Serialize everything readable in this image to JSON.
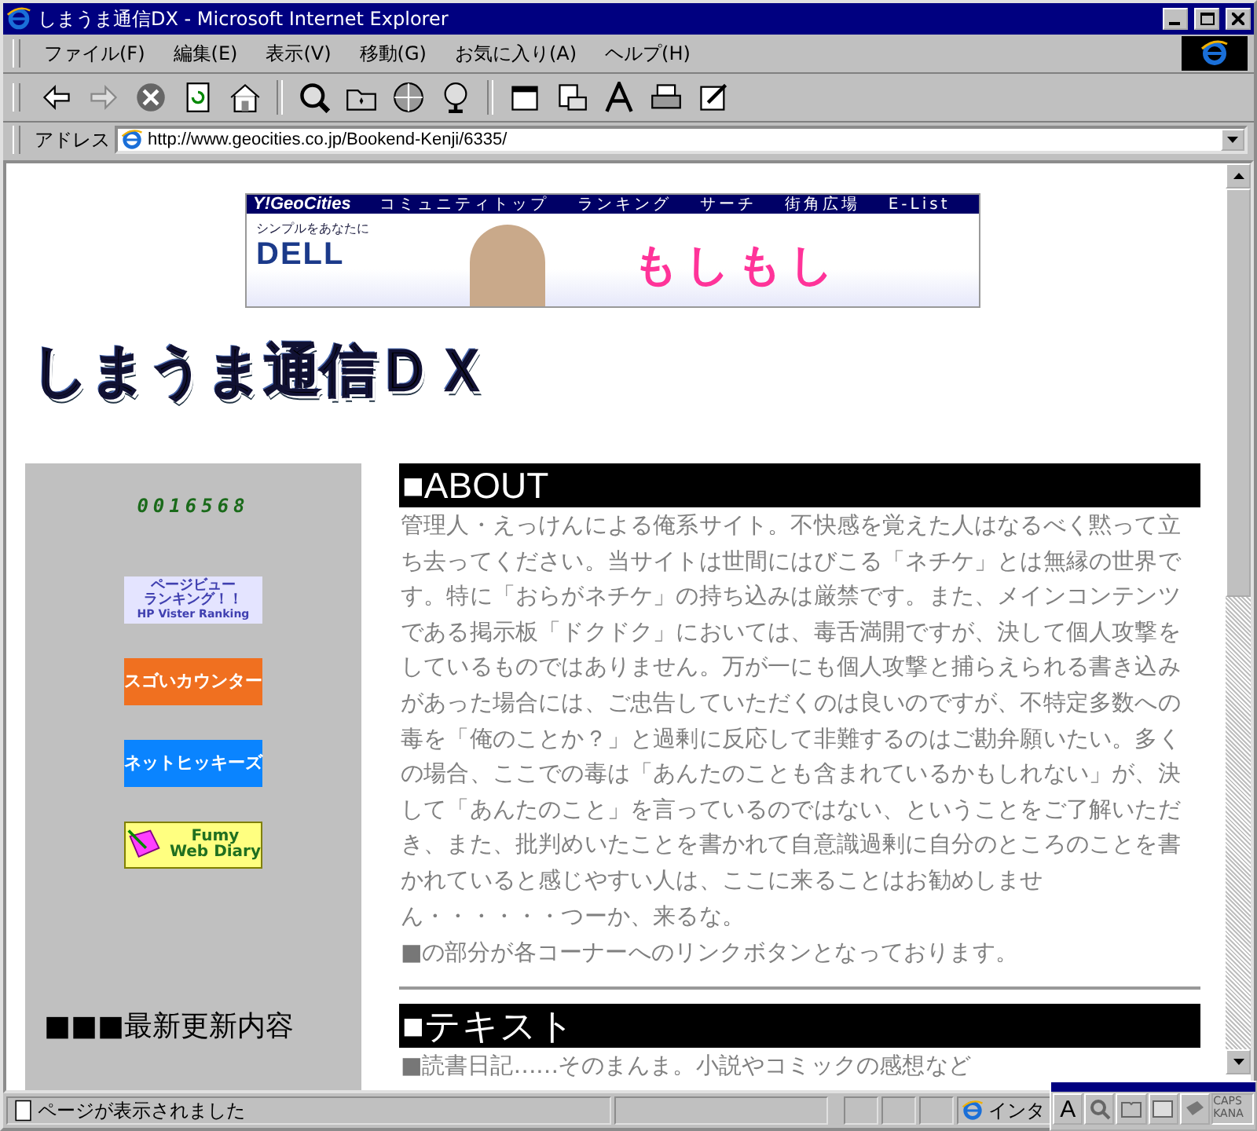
{
  "window": {
    "title": "しまうま通信DX - Microsoft Internet Explorer"
  },
  "menu": [
    "ファイル(F)",
    "編集(E)",
    "表示(V)",
    "移動(G)",
    "お気に入り(A)",
    "ヘルプ(H)"
  ],
  "address": {
    "label": "アドレス",
    "url": "http://www.geocities.co.jp/Bookend-Kenji/6335/"
  },
  "banner": {
    "brand": "Y!GeoCities",
    "links": [
      "コミュニティトップ",
      "ランキング",
      "サーチ",
      "街角広場",
      "E-List"
    ],
    "tagline": "シンプルをあなたに",
    "logo": "DELL",
    "ad_text": "もしもし"
  },
  "site_title": "しまうま通信ＤＸ",
  "sidebar": {
    "counter": "0016568",
    "badges": [
      {
        "kind": "ranking",
        "lines": [
          "ページビュー",
          "ランキング！！"
        ],
        "sub": "HP Vister Ranking"
      },
      {
        "kind": "orange",
        "lines": [
          "スゴいカウンター"
        ]
      },
      {
        "kind": "blue",
        "lines": [
          "ネットヒッキーズ"
        ]
      },
      {
        "kind": "diary",
        "lines": [
          "Fumy",
          "Web Diary"
        ]
      }
    ],
    "heading": "■■■最新更新内容"
  },
  "sections": [
    {
      "heading": "■ABOUT",
      "body": "管理人・えっけんによる俺系サイト。不快感を覚えた人はなるべく黙って立ち去ってください。当サイトは世間にはびこる「ネチケ」とは無縁の世界です。特に「おらがネチケ」の持ち込みは厳禁です。また、メインコンテンツである掲示板「ドクドク」においては、毒舌満開ですが、決して個人攻撃をしているものではありません。万が一にも個人攻撃と捕らえられる書き込みがあった場合には、ご忠告していただくのは良いのですが、不特定多数への毒を「俺のことか？」と過剰に反応して非難するのはご勘弁願いたい。多くの場合、ここでの毒は「あんたのことも含まれているかもしれない」が、決して「あんたのこと」を言っているのではない、ということをご了解いただき、また、批判めいたことを書かれて自意識過剰に自分のところのことを書かれていると感じやすい人は、ここに来ることはお勧めしません・・・・・・つーか、来るな。",
      "items": [
        {
          "marker": "■",
          "text": "の部分が各コーナーへのリンクボタンとなっております。"
        }
      ]
    },
    {
      "heading": "■テキスト",
      "items": [
        {
          "marker": "■",
          "text": "読書日記……そのまんま。小説やコミックの感想など"
        }
      ]
    }
  ],
  "status_bar": {
    "text": "ページが表示されました",
    "zone": "インタ"
  },
  "ime_bar": {
    "key": "A",
    "caps": "CAPS",
    "kana": "KANA"
  }
}
